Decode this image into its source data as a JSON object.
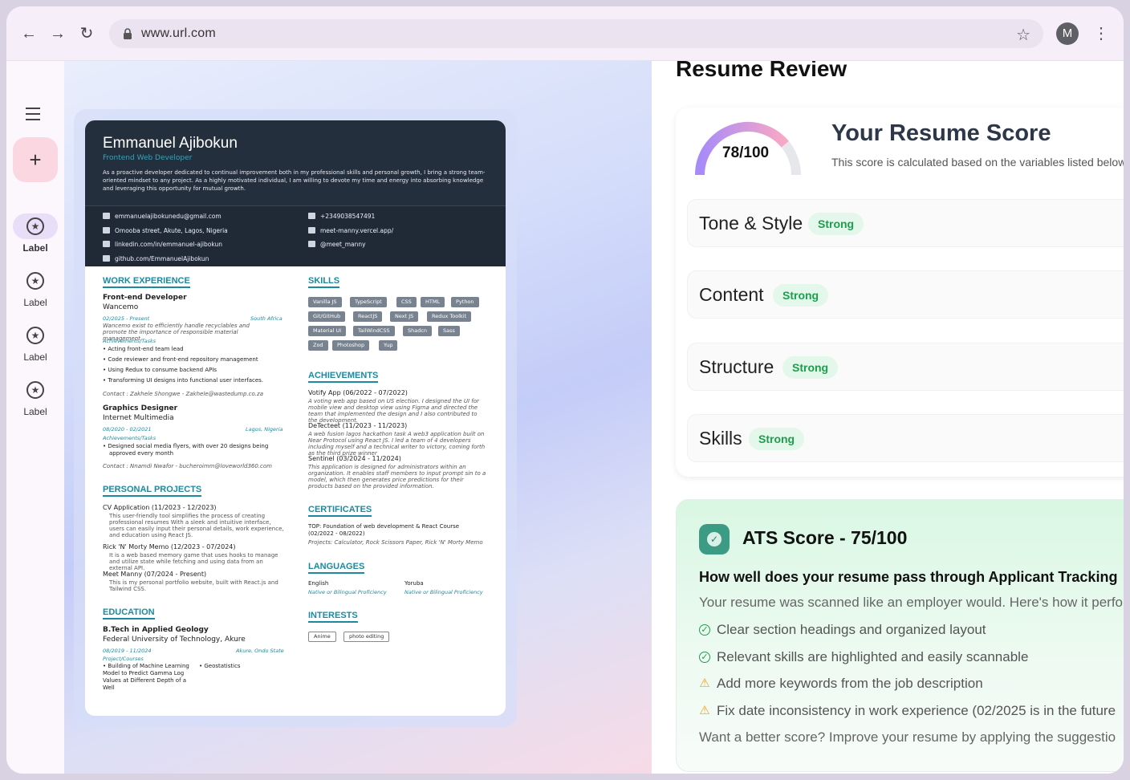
{
  "browser": {
    "url": "www.url.com",
    "avatar_letter": "M"
  },
  "rail": {
    "items": [
      {
        "label": "Label",
        "active": true
      },
      {
        "label": "Label",
        "active": false
      },
      {
        "label": "Label",
        "active": false
      },
      {
        "label": "Label",
        "active": false
      }
    ]
  },
  "resume": {
    "name": "Emmanuel Ajibokun",
    "role": "Frontend Web Developer",
    "bio": "As a proactive developer dedicated to continual improvement both in my professional skills and personal growth, I bring a strong team-oriented mindset to any project. As a highly motivated individual, I am willing to devote my time and energy into absorbing knowledge and leveraging this opportunity for mutual growth.",
    "contacts": {
      "email": "emmanuelajibokunedu@gmail.com",
      "phone": "+2349038547491",
      "address": "Omooba street, Akute, Lagos, Nigeria",
      "website": "meet-manny.vercel.app/",
      "linkedin": "linkedin.com/in/emmanuel-ajibokun",
      "twitter": "@meet_manny",
      "github": "github.com/EmmanuelAjibokun"
    },
    "work": {
      "heading": "WORK EXPERIENCE",
      "job1_title": "Front-end Developer",
      "job1_company": "Wancemo",
      "job1_date": "02/2025 - Present",
      "job1_location": "South Africa",
      "job1_desc": "Wancemo exist to efficiently handle recyclables and promote the importance of responsible material management.",
      "job1_tasks_label": "Achievements/Tasks",
      "job1_tasks": [
        "Acting front-end team lead",
        "Code reviewer and front-end repository management",
        "Using Redux to consume backend APIs",
        "Transforming UI designs into functional user interfaces."
      ],
      "job1_contact": "Contact : Zakhele Shongwe - Zakhele@wastedump.co.za",
      "job2_title": "Graphics Designer",
      "job2_company": "Internet Multimedia",
      "job2_date": "08/2020 - 02/2021",
      "job2_location": "Lagos, Nigeria",
      "job2_tasks_label": "Achievements/Tasks",
      "job2_task1": "Designed social media flyers, with over 20 designs being",
      "job2_task1b": "approved every month",
      "job2_contact": "Contact : Nnamdi Nwafor - bucheroimm@loveworld360.com"
    },
    "projects": {
      "heading": "PERSONAL PROJECTS",
      "p1_title": "CV Application (11/2023 - 12/2023)",
      "p1_desc": "This user-friendly tool simplifies the process of creating professional resumes With a sleek and intuitive interface, users can easily input their personal details, work experience, and education using React JS.",
      "p2_title": "Rick 'N' Morty Memo (12/2023 - 07/2024)",
      "p2_desc": "It is a web based memory game that uses hooks to manage and utilize state while fetching and using data from an external API.",
      "p3_title": "Meet Manny (07/2024 - Present)",
      "p3_desc": "This is my personal portfolio website, built with React.js and Tailwind CSS."
    },
    "education": {
      "heading": "EDUCATION",
      "degree": "B.Tech in Applied Geology",
      "school": "Federal University of Technology, Akure",
      "date": "08/2019 - 11/2024",
      "location": "Akure, Ondo State",
      "courses_label": "Project/Courses",
      "course1": "Building of Machine Learning Model to Predict Gamma Log Values at Different Depth of a Well",
      "course2": "Geostatistics"
    },
    "skills": {
      "heading": "SKILLS",
      "list": [
        "Vanilla JS",
        "TypeScript",
        "CSS",
        "HTML",
        "Python",
        "Git/GitHub",
        "ReactJS",
        "Next JS",
        "Redux Toolkit",
        "Material UI",
        "TailWindCSS",
        "Shadcn",
        "Sass",
        "Zod",
        "Photoshop",
        "Yup"
      ]
    },
    "achievements": {
      "heading": "ACHIEVEMENTS",
      "a1_title": "Votify App (06/2022 - 07/2022)",
      "a1_desc": "A voting web app based on US election. I designed the UI for mobile view and desktop view using Figma and directed the team that implemented the design and I also contributed to the development.",
      "a2_title": "DeTecteet (11/2023 - 11/2023)",
      "a2_desc": "A web fusion lagos hackathon task A web3 application built on Near Protocol using React JS. I led a team of 4 developers including myself and a technical writer to victory, coming forth as the third prize winner",
      "a3_title": "Sentinel (03/2024 - 11/2024)",
      "a3_desc": "This application is designed for administrators within an organization. It enables staff members to input prompt sin to a model, which then generates price predictions for their products based on the provided information."
    },
    "certificates": {
      "heading": "CERTIFICATES",
      "c1": "TOP: Foundation of web development & React Course",
      "c1_date": "(02/2022 - 08/2022)",
      "c1_projects": "Projects: Calculator, Rock Scissors Paper, Rick 'N' Morty Memo"
    },
    "languages": {
      "heading": "LANGUAGES",
      "l1": "English",
      "l1_level": "Native or Bilingual Proficiency",
      "l2": "Yoruba",
      "l2_level": "Native or Bilingual Proficiency"
    },
    "interests": {
      "heading": "INTERESTS",
      "list": [
        "Anime",
        "photo editing"
      ]
    }
  },
  "review": {
    "title": "Resume Review",
    "score_label": "78/100",
    "score_value": 78,
    "score_title": "Your Resume Score",
    "score_sub": "This score is calculated based on the variables listed below.",
    "categories": [
      {
        "name": "Tone & Style",
        "badge": "Strong"
      },
      {
        "name": "Content",
        "badge": "Strong"
      },
      {
        "name": "Structure",
        "badge": "Strong"
      },
      {
        "name": "Skills",
        "badge": "Strong"
      }
    ],
    "ats": {
      "title": "ATS Score - 75/100",
      "question": "How well does your resume pass through Applicant Tracking",
      "intro": "Your resume was scanned like an employer would. Here's how it perfo",
      "items": [
        {
          "text": "Clear section headings and organized layout",
          "type": "good"
        },
        {
          "text": "Relevant skills are highlighted and easily scannable",
          "type": "good"
        },
        {
          "text": "Add more keywords from the job description",
          "type": "warning"
        },
        {
          "text": "Fix date inconsistency in work experience (02/2025 is in the future",
          "type": "warning"
        }
      ],
      "footer": "Want a better score? Improve your resume by applying the suggestio"
    },
    "colors": {
      "accent_green": "#1f9d4f",
      "warning": "#e8a31a",
      "gauge_start": "#a78bfa",
      "gauge_end": "#f9a8c4"
    }
  }
}
